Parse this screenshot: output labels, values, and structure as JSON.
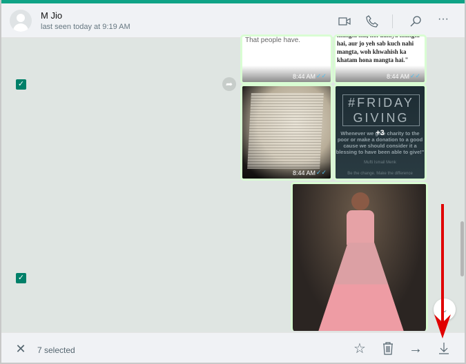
{
  "header": {
    "contact_name": "M Jio",
    "last_seen": "last seen today at 9:19 AM"
  },
  "messages": {
    "tile1_text": "That people have.",
    "tile2_text": "mangta hai, koi duniya mangta hai, aur jo yeh sab kuch nahi mangta, woh khwahish ka khatam hona mangta hai.\"",
    "time": "8:44 AM",
    "friday_title1": "#FRIDAY",
    "friday_title2": "GIVING",
    "friday_quote": "Whenever we give charity to the poor or make a donation to a good cause we should consider it a blessing to have been able to give!\"",
    "friday_author": "Mufti Ismail Menk",
    "friday_footer": "Be the change. Make the difference",
    "more_count": "+3"
  },
  "selection": {
    "count_label": "7 selected"
  },
  "colors": {
    "accent": "#0fa386",
    "checkbox": "#008069",
    "arrow": "#e00000"
  }
}
